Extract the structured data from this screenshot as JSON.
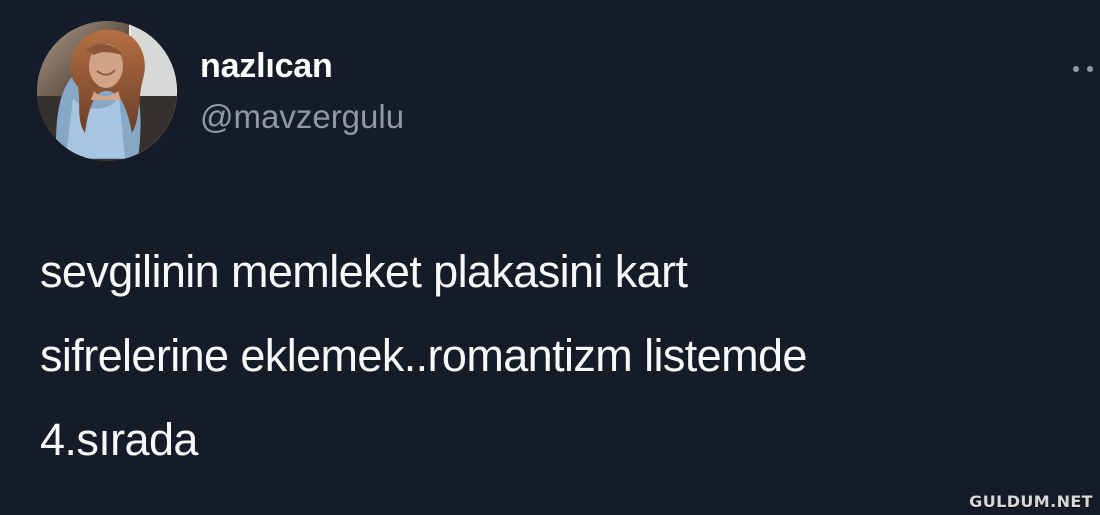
{
  "tweet": {
    "author": {
      "display_name": "nazlıcan",
      "username": "@mavzergulu"
    },
    "more_icon": "more-options-icon",
    "text_lines": [
      "sevgilinin memleket plakasini kart",
      "sifrelerine eklemek..romantizm listemde",
      "4.sırada"
    ]
  },
  "watermark": {
    "text": "GULDUM.NET"
  },
  "colors": {
    "background": "#151c27",
    "primary_text": "#f7f9f9",
    "secondary_text": "#8d99a5"
  }
}
